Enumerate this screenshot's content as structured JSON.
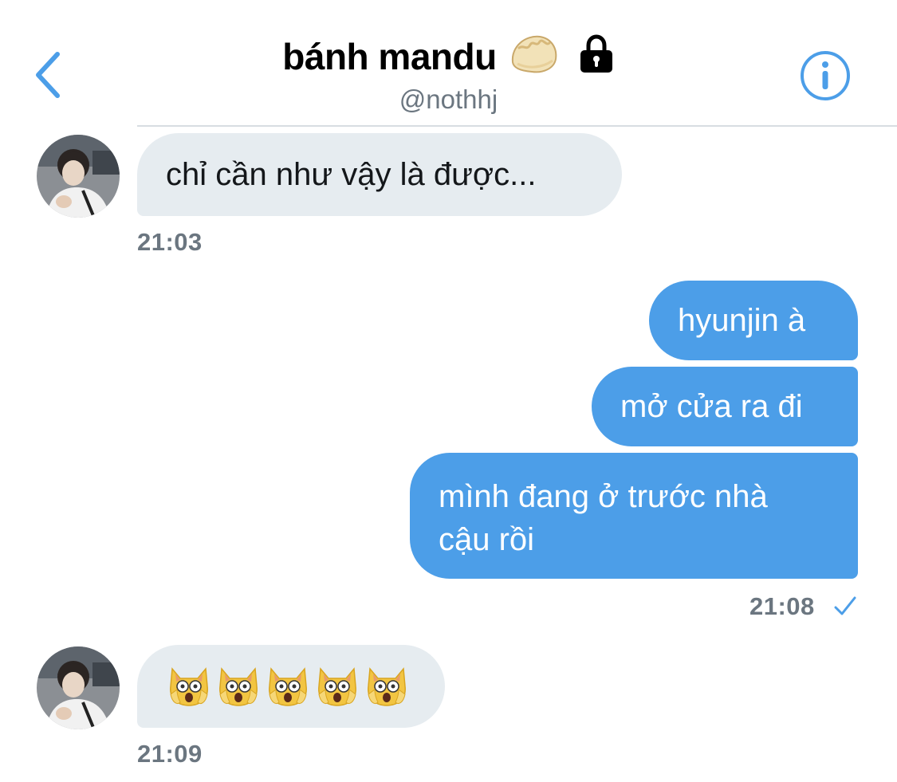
{
  "header": {
    "title": "bánh mandu",
    "handle": "@nothhj",
    "title_emoji": "dumpling",
    "locked": true
  },
  "colors": {
    "accent": "#4c9ee8",
    "incoming_bubble": "#e6ecf0",
    "muted_text": "#6b7680"
  },
  "messages": [
    {
      "direction": "incoming",
      "text": "chỉ cần như vậy là được..."
    },
    {
      "direction": "incoming_time",
      "text": "21:03"
    },
    {
      "direction": "outgoing",
      "text": "hyunjin à"
    },
    {
      "direction": "outgoing",
      "text": "mở cửa ra đi"
    },
    {
      "direction": "outgoing",
      "text": "mình đang ở trước nhà cậu rồi"
    },
    {
      "direction": "outgoing_time",
      "text": "21:08",
      "status": "sent-check"
    },
    {
      "direction": "incoming",
      "emoji": "weary-cat-face",
      "count": 5
    },
    {
      "direction": "incoming_time",
      "text": "21:09"
    }
  ]
}
